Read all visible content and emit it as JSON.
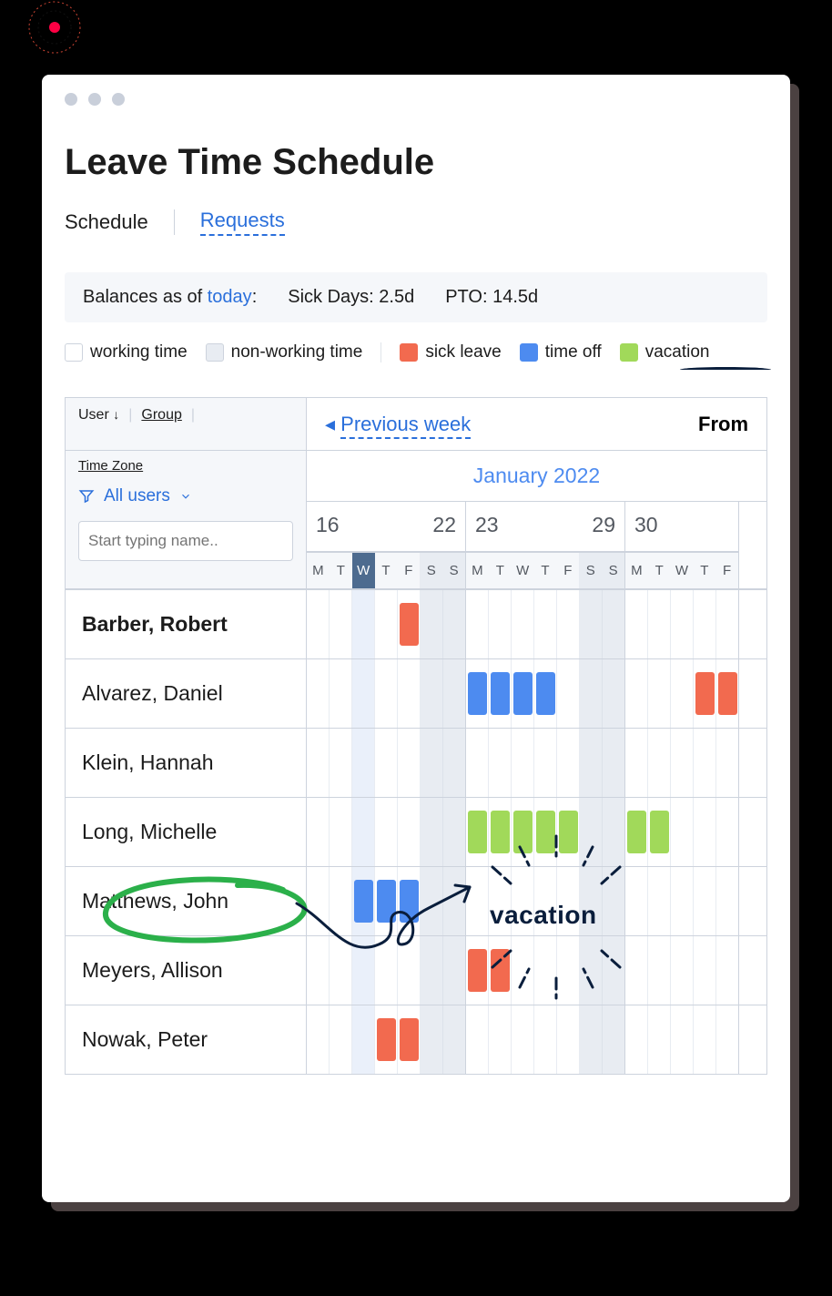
{
  "title": "Leave Time Schedule",
  "tabs": {
    "schedule": "Schedule",
    "requests": "Requests"
  },
  "balances": {
    "prefix": "Balances as of ",
    "today": "today",
    "suffix": ":",
    "sick": "Sick Days: 2.5d",
    "pto": "PTO: 14.5d"
  },
  "legend": {
    "working": "working time",
    "nonworking": "non-working time",
    "sick": "sick leave",
    "timeoff": "time off",
    "vacation": "vacation"
  },
  "sidebar": {
    "user": "User",
    "group": "Group",
    "timezone": "Time Zone",
    "allusers": "All users",
    "search_placeholder": "Start typing name.."
  },
  "calendar": {
    "prev": "Previous week",
    "from": "From",
    "month": "January 2022",
    "groups": [
      {
        "start": "16",
        "end": "22",
        "days": [
          "M",
          "T",
          "W",
          "T",
          "F",
          "S",
          "S"
        ]
      },
      {
        "start": "23",
        "end": "29",
        "days": [
          "M",
          "T",
          "W",
          "T",
          "F",
          "S",
          "S"
        ]
      },
      {
        "start": "30",
        "end": "",
        "days": [
          "M",
          "T",
          "W",
          "T",
          "F"
        ]
      }
    ]
  },
  "annotation": {
    "vacation": "vacation"
  },
  "users": [
    {
      "name": "Barber, Robert",
      "bold": true,
      "cells": {
        "4": "red"
      }
    },
    {
      "name": "Alvarez, Daniel",
      "bold": false,
      "cells": {
        "7": "blue",
        "8": "blue",
        "9": "blue",
        "10": "blue",
        "17": "red",
        "18": "red"
      }
    },
    {
      "name": "Klein, Hannah",
      "bold": false,
      "cells": {}
    },
    {
      "name": "Long, Michelle",
      "bold": false,
      "cells": {
        "7": "green",
        "8": "green",
        "9": "green",
        "10": "green",
        "11": "green",
        "14": "green",
        "15": "green"
      }
    },
    {
      "name": "Matthews, John",
      "bold": false,
      "cells": {
        "2": "blue",
        "3": "blue",
        "4": "blue"
      }
    },
    {
      "name": "Meyers, Allison",
      "bold": false,
      "cells": {
        "7": "red",
        "8": "red"
      }
    },
    {
      "name": "Nowak, Peter",
      "bold": false,
      "cells": {
        "3": "red",
        "4": "red"
      }
    }
  ]
}
